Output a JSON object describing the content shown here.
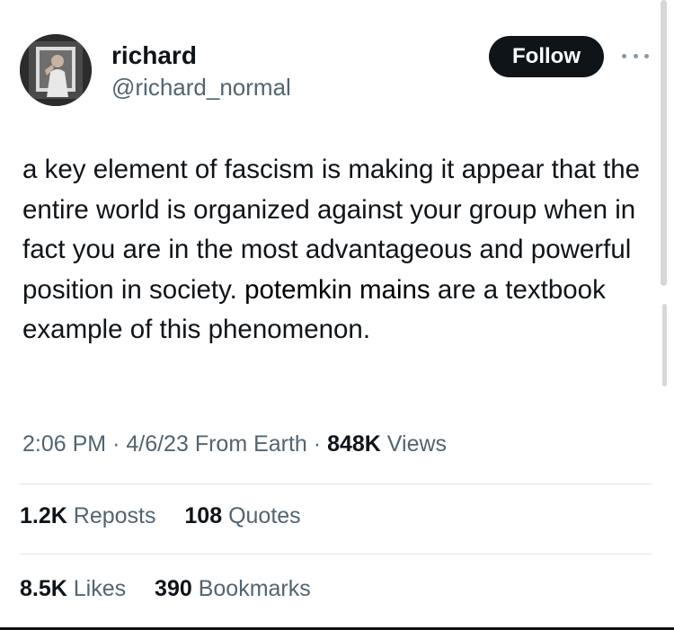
{
  "author": {
    "name": "richard",
    "handle": "@richard_normal"
  },
  "actions": {
    "follow_label": "Follow"
  },
  "tweet": {
    "text_part1": "a key element of fascism is making it appear that the entire world is organized against your group when in fact you are in the most advantageous and powerful position in society.",
    "inserted_part1": "potemkin",
    "inserted_part2": "mains",
    "text_part2": "are a textbook example of this phenomenon."
  },
  "meta": {
    "time": "2:06 PM",
    "date": "4/6/23",
    "source": "From Earth",
    "views_count": "848K",
    "views_label": "Views",
    "separator": "·"
  },
  "stats": {
    "reposts_count": "1.2K",
    "reposts_label": "Reposts",
    "quotes_count": "108",
    "quotes_label": "Quotes",
    "likes_count": "8.5K",
    "likes_label": "Likes",
    "bookmarks_count": "390",
    "bookmarks_label": "Bookmarks"
  },
  "colors": {
    "text": "#0f1419",
    "secondary": "#536471",
    "button_bg": "#0f1419"
  }
}
